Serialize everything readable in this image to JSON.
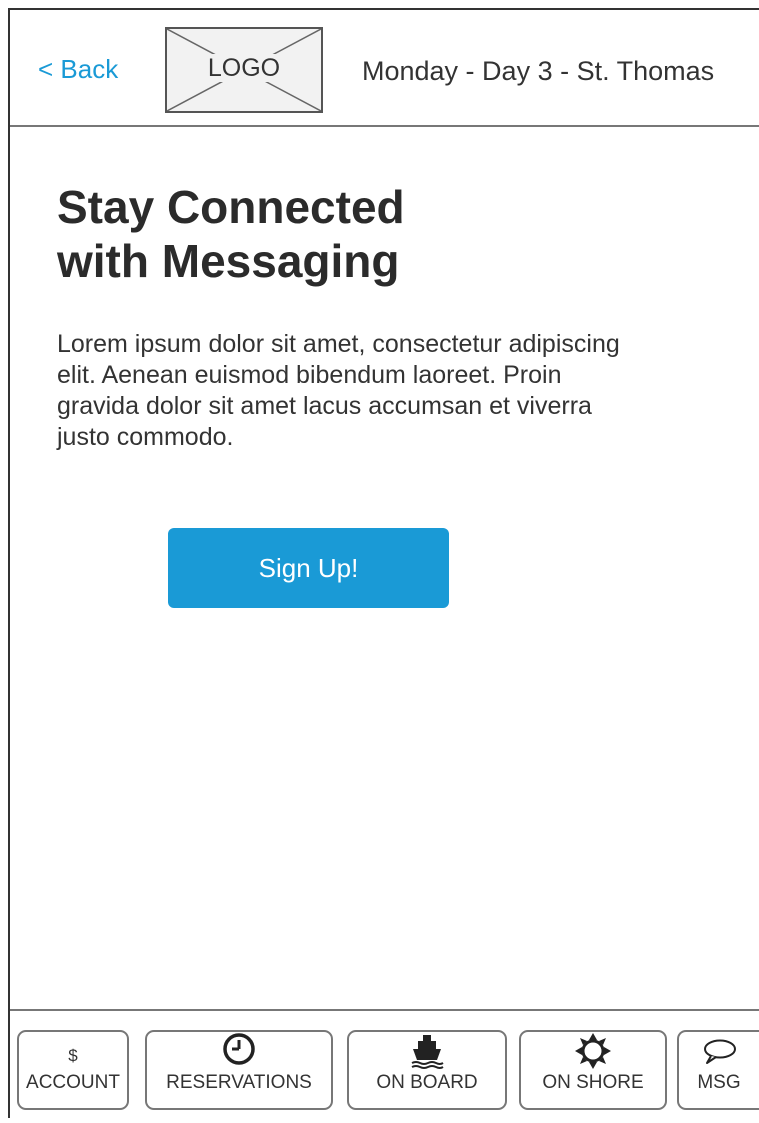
{
  "header": {
    "back_label": "< Back",
    "logo_label": "LOGO",
    "day_title": "Monday - Day 3 - St. Thomas"
  },
  "main": {
    "title_lines": [
      "Stay Connected",
      "with Messaging"
    ],
    "body_lines": [
      "Lorem ipsum dolor sit amet, consectetur adipiscing",
      "elit. Aenean euismod bibendum laoreet. Proin",
      "gravida dolor sit amet lacus accumsan et viverra",
      "justo commodo."
    ],
    "signup_label": "Sign Up!"
  },
  "colors": {
    "accent": "#1a9ad6"
  },
  "bottom_nav": {
    "items": [
      {
        "label": "ACCOUNT",
        "icon": "dollar-icon",
        "glyph": "$"
      },
      {
        "label": "RESERVATIONS",
        "icon": "clock-icon"
      },
      {
        "label": "ON BOARD",
        "icon": "ship-icon"
      },
      {
        "label": "ON SHORE",
        "icon": "sun-icon"
      },
      {
        "label": "MSG",
        "icon": "speech-bubble-icon"
      }
    ]
  }
}
